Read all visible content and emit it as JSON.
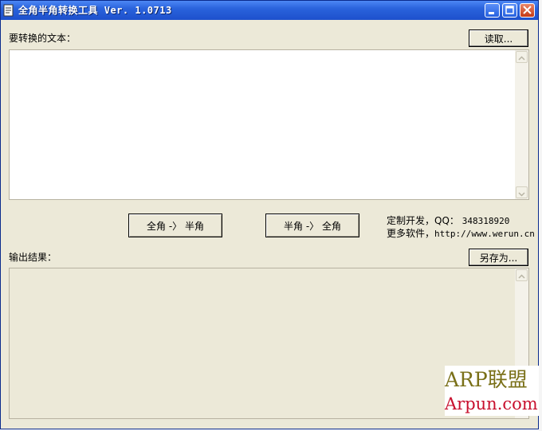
{
  "window": {
    "title": "全角半角转换工具 Ver. 1.0713",
    "icons": {
      "app": "app-document-icon",
      "minimize": "minimize-icon",
      "maximize": "maximize-icon",
      "close": "close-icon"
    },
    "colors": {
      "titlebar": "#2a63dc",
      "face": "#ece9d8",
      "close_button": "#c43a15"
    }
  },
  "input": {
    "label": "要转换的文本：",
    "read_button": "读取...",
    "value": ""
  },
  "actions": {
    "to_half": "全角 -〉 半角",
    "to_full": "半角 -〉 全角"
  },
  "info": {
    "qq_prefix": "定制开发，QQ：",
    "qq_value": "348318920",
    "more_prefix": "更多软件，",
    "more_url": "http://www.werun.cn"
  },
  "output": {
    "label": "输出结果：",
    "save_button": "另存为...",
    "value": ""
  },
  "watermark": {
    "line1": "ARP联盟",
    "line2": "Arpun.com",
    "colors": {
      "line1": "#7a7018",
      "line2": "#c8102e"
    }
  }
}
